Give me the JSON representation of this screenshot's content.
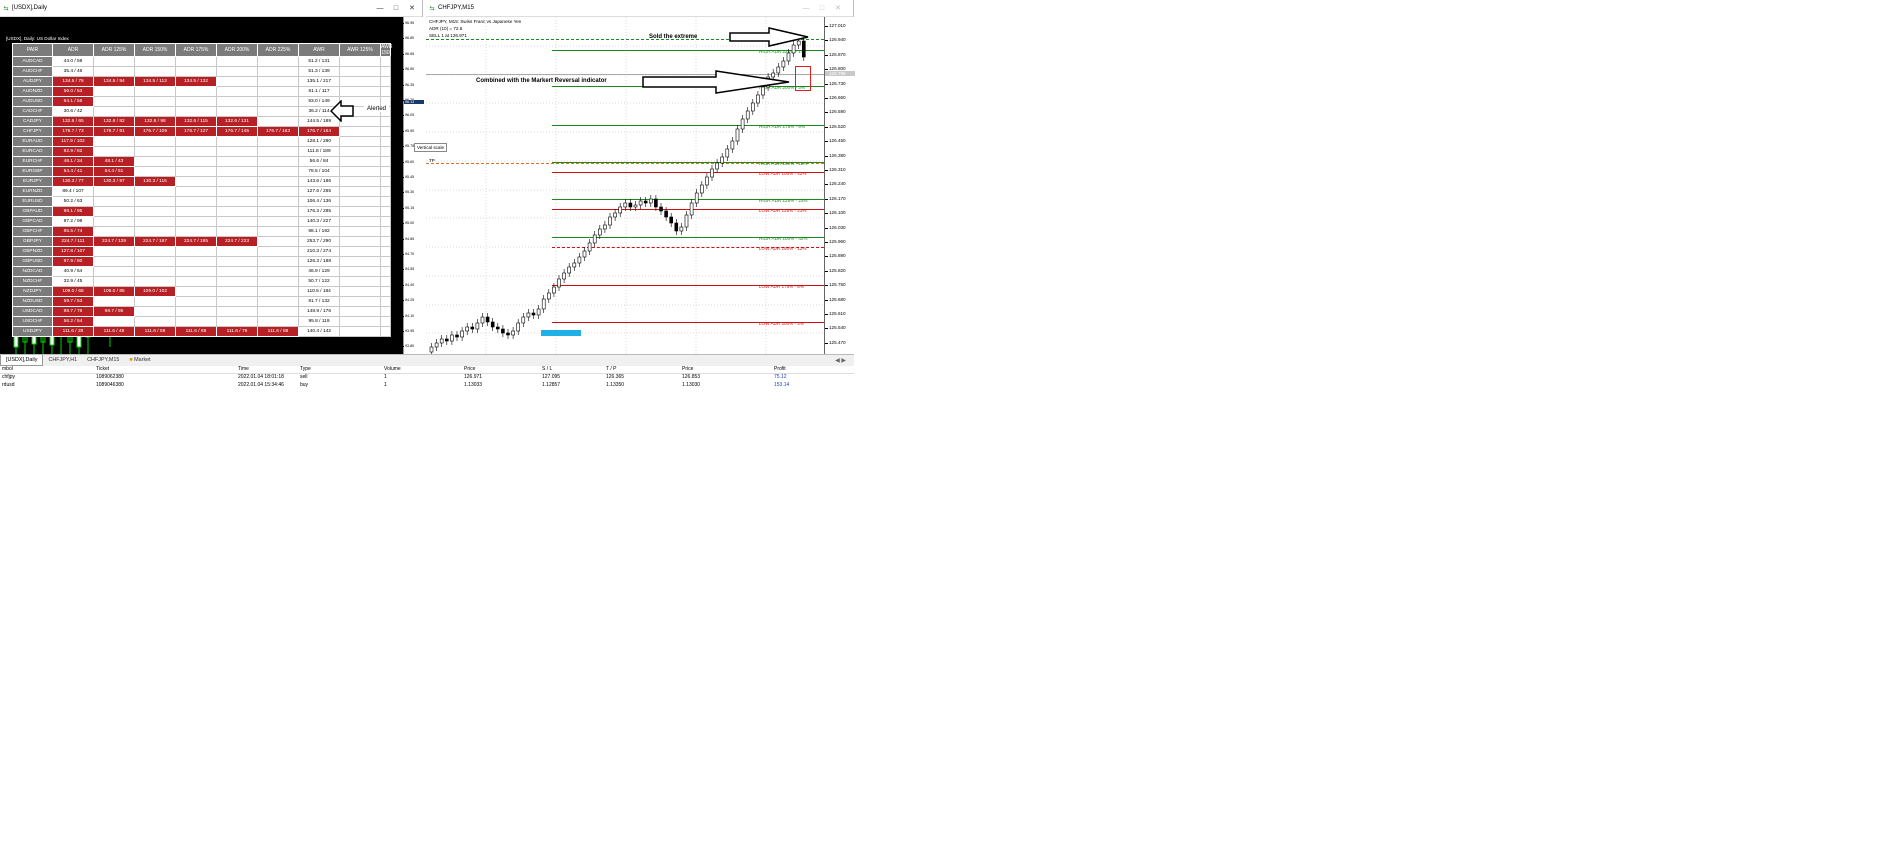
{
  "left_window": {
    "title": "[USDX],Daily",
    "info": "[USDX], Daily:  US Dollar Index",
    "vscale_tooltip": "Vertical scale",
    "scale_current": "96.13",
    "scale": [
      "96.95",
      "96.80",
      "96.65",
      "96.50",
      "96.35",
      "96.20",
      "96.05",
      "95.90",
      "95.75",
      "95.60",
      "95.45",
      "95.30",
      "95.15",
      "95.00",
      "94.85",
      "94.70",
      "94.55",
      "94.40",
      "94.25",
      "94.10",
      "93.95",
      "93.80",
      "93.65"
    ],
    "annotation": "Alerted"
  },
  "adr_table": {
    "headers": [
      "PAIR",
      "ADR",
      "ADR 125%",
      "ADR 150%",
      "ADR 175%",
      "ADR 200%",
      "ADR 225%",
      "AWR",
      "AWR 125%",
      "AWR 150"
    ],
    "rows": [
      {
        "pair": "AUDCAD",
        "cells": [
          "44.0 / 59",
          "",
          "",
          "",
          "",
          "",
          "51.2 / 131",
          "",
          ""
        ],
        "red": 0
      },
      {
        "pair": "AUDCHF",
        "cells": [
          "35.4 / 46",
          "",
          "",
          "",
          "",
          "",
          "51.3 / 139",
          "",
          ""
        ],
        "red": 0
      },
      {
        "pair": "AUDJPY",
        "cells": [
          "134.5 / 76",
          "134.5 / 94",
          "134.5 / 113",
          "134.5 / 132",
          "",
          "",
          "135.1 / 217",
          "",
          ""
        ],
        "red": 4
      },
      {
        "pair": "AUDNZD",
        "cells": [
          "56.0 / 53",
          "",
          "",
          "",
          "",
          "",
          "61.1 / 117",
          "",
          ""
        ],
        "red": 1
      },
      {
        "pair": "AUDUSD",
        "cells": [
          "64.1 / 55",
          "",
          "",
          "",
          "",
          "",
          "93.0 / 149",
          "",
          ""
        ],
        "red": 1
      },
      {
        "pair": "CADCHF",
        "cells": [
          "30.6 / 42",
          "",
          "",
          "",
          "",
          "",
          "36.2 / 114",
          "",
          ""
        ],
        "red": 0
      },
      {
        "pair": "CADJPY",
        "cells": [
          "132.6 / 65",
          "132.6 / 82",
          "132.6 / 98",
          "132.6 / 115",
          "132.6 / 131",
          "",
          "144.5 / 189",
          "",
          ""
        ],
        "red": 5
      },
      {
        "pair": "CHFJPY",
        "cells": [
          "176.7 / 73",
          "176.7 / 91",
          "176.7 / 109",
          "176.7 / 127",
          "176.7 / 145",
          "176.7 / 163",
          "176.7 / 164",
          "",
          ""
        ],
        "red": 7
      },
      {
        "pair": "EURAUD",
        "cells": [
          "117.9 / 102",
          "",
          "",
          "",
          "",
          "",
          "128.1 / 280",
          "",
          ""
        ],
        "red": 1
      },
      {
        "pair": "EURCAD",
        "cells": [
          "92.9 / 82",
          "",
          "",
          "",
          "",
          "",
          "111.8 / 189",
          "",
          ""
        ],
        "red": 1
      },
      {
        "pair": "EURCHF",
        "cells": [
          "48.1 / 34",
          "48.1 / 43",
          "",
          "",
          "",
          "",
          "56.6 / 84",
          "",
          ""
        ],
        "red": 2
      },
      {
        "pair": "EURGBP",
        "cells": [
          "54.4 / 41",
          "54.4 / 51",
          "",
          "",
          "",
          "",
          "78.5 / 104",
          "",
          ""
        ],
        "red": 2
      },
      {
        "pair": "EURJPY",
        "cells": [
          "130.3 / 77",
          "130.3 / 97",
          "130.3 / 116",
          "",
          "",
          "",
          "143.6 / 186",
          "",
          ""
        ],
        "red": 3
      },
      {
        "pair": "EURNZD",
        "cells": [
          "89.4 / 107",
          "",
          "",
          "",
          "",
          "",
          "127.6 / 265",
          "",
          ""
        ],
        "red": 0
      },
      {
        "pair": "EURUSD",
        "cells": [
          "50.2 / 63",
          "",
          "",
          "",
          "",
          "",
          "106.4 / 136",
          "",
          ""
        ],
        "red": 0
      },
      {
        "pair": "GBPAUD",
        "cells": [
          "98.1 / 95",
          "",
          "",
          "",
          "",
          "",
          "176.3 / 285",
          "",
          ""
        ],
        "red": 1
      },
      {
        "pair": "GBPCAD",
        "cells": [
          "87.2 / 99",
          "",
          "",
          "",
          "",
          "",
          "140.3 / 227",
          "",
          ""
        ],
        "red": 0
      },
      {
        "pair": "GBPCHF",
        "cells": [
          "85.5 / 74",
          "",
          "",
          "",
          "",
          "",
          "98.1 / 192",
          "",
          ""
        ],
        "red": 1
      },
      {
        "pair": "GBPJPY",
        "cells": [
          "224.7 / 111",
          "224.7 / 139",
          "224.7 / 167",
          "224.7 / 195",
          "224.7 / 223",
          "",
          "253.7 / 290",
          "",
          ""
        ],
        "red": 5
      },
      {
        "pair": "GBPNZD",
        "cells": [
          "127.8 / 107",
          "",
          "",
          "",
          "",
          "",
          "210.3 / 274",
          "",
          ""
        ],
        "red": 1
      },
      {
        "pair": "GBPUSD",
        "cells": [
          "97.9 / 80",
          "",
          "",
          "",
          "",
          "",
          "126.3 / 188",
          "",
          ""
        ],
        "red": 1
      },
      {
        "pair": "NZDCAD",
        "cells": [
          "40.9 / 54",
          "",
          "",
          "",
          "",
          "",
          "46.9 / 129",
          "",
          ""
        ],
        "red": 0
      },
      {
        "pair": "NZDCHF",
        "cells": [
          "32.9 / 45",
          "",
          "",
          "",
          "",
          "",
          "50.7 / 122",
          "",
          ""
        ],
        "red": 0
      },
      {
        "pair": "NZDJPY",
        "cells": [
          "109.0 / 68",
          "109.0 / 85",
          "109.0 / 102",
          "",
          "",
          "",
          "110.5 / 184",
          "",
          ""
        ],
        "red": 3
      },
      {
        "pair": "NZDUSD",
        "cells": [
          "59.7 / 53",
          "",
          "",
          "",
          "",
          "",
          "91.7 / 132",
          "",
          ""
        ],
        "red": 1
      },
      {
        "pair": "USDCAD",
        "cells": [
          "98.7 / 76",
          "98.7 / 95",
          "",
          "",
          "",
          "",
          "148.9 / 176",
          "",
          ""
        ],
        "red": 2
      },
      {
        "pair": "USDCHF",
        "cells": [
          "56.2 / 54",
          "",
          "",
          "",
          "",
          "",
          "95.8 / 119",
          "",
          ""
        ],
        "red": 1
      },
      {
        "pair": "USDJPY",
        "cells": [
          "111.6 / 39",
          "111.6 / 49",
          "111.6 / 59",
          "111.6 / 69",
          "111.6 / 79",
          "111.6 / 88",
          "140.4 / 142",
          "",
          ""
        ],
        "red": 6
      }
    ]
  },
  "right_window": {
    "title": "CHFJPY,M15",
    "info_line1": "CHFJPY, M15:  Swiss Franc vs Japanese Yen",
    "info_line2": "ADR (10) = 72.6",
    "info_line3": "SELL 1 at 126.971",
    "tp_label": "TP",
    "current_price": "126.799",
    "scale": [
      "127.010",
      "126.940",
      "126.870",
      "126.800",
      "126.730",
      "126.660",
      "126.590",
      "126.520",
      "126.450",
      "126.380",
      "126.310",
      "126.240",
      "126.170",
      "126.100",
      "126.030",
      "125.960",
      "125.890",
      "125.820",
      "125.750",
      "125.680",
      "125.610",
      "125.540",
      "125.470"
    ],
    "annotation_top": "Sold the extreme",
    "annotation_mid": "Combined with the Markert Reversal indicator",
    "levels": [
      {
        "label": "HIGH ADR 225% - 1%",
        "color": "#1a8a1a"
      },
      {
        "label": "HIGH ADR 200% - 3%",
        "color": "#1a8a1a"
      },
      {
        "label": "HIGH ADR 175% - 6%",
        "color": "#1a8a1a"
      },
      {
        "label": "HIGH ADR 150% - 12%",
        "color": "#1a8a1a"
      },
      {
        "label": "LOW ADR 100% - 42%",
        "color": "#d01010"
      },
      {
        "label": "HIGH ADR 125% - 23%",
        "color": "#1a8a1a"
      },
      {
        "label": "LOW ADR 125% - 23%",
        "color": "#d01010"
      },
      {
        "label": "HIGH ADR 100% - 42%",
        "color": "#1a8a1a"
      },
      {
        "label": "LOW ADR 150% - 12%",
        "color": "#d01010"
      },
      {
        "label": "LOW ADR 175% - 8%",
        "color": "#d01010"
      },
      {
        "label": "LOW ADR 200% - 3%",
        "color": "#d01010"
      }
    ]
  },
  "tabs": [
    "[USDX],Daily",
    "CHFJPY,H1",
    "CHFJPY,M15",
    "Market"
  ],
  "terminal": {
    "headers": [
      "mbol",
      "Ticket",
      "Time",
      "Type",
      "Volume",
      "Price",
      "S / L",
      "T / P",
      "Price",
      "Profit"
    ],
    "rows": [
      [
        "chfjpy",
        "1089062380",
        "2022.01.04 18:01:18",
        "sell",
        "1",
        "126.971",
        "127.095",
        "126.365",
        "126.853",
        "75.12"
      ],
      [
        "rdusd",
        "1089046380",
        "2022.01.04 15:34:46",
        "buy",
        "1",
        "1.13033",
        "1.12857",
        "1.13350",
        "1.13030",
        "153.14"
      ]
    ]
  }
}
